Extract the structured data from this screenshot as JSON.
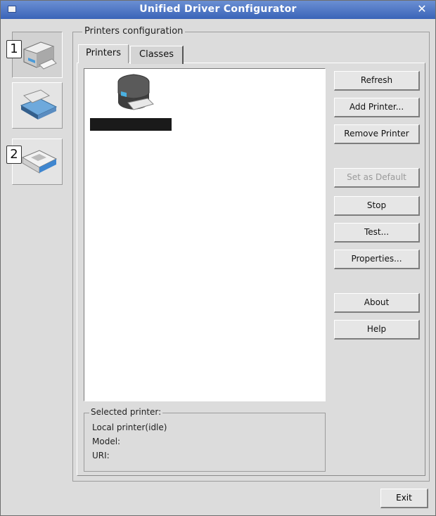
{
  "window": {
    "title": "Unified Driver Configurator"
  },
  "sidebar": {
    "items": [
      {
        "name": "printers-configuration",
        "icon": "printer-icon",
        "badge": "1",
        "active": true
      },
      {
        "name": "scanners-configuration",
        "icon": "scanner-icon",
        "badge": "",
        "active": false
      },
      {
        "name": "ports-configuration",
        "icon": "port-icon",
        "badge": "2",
        "active": false
      }
    ]
  },
  "group": {
    "label": "Printers configuration"
  },
  "tabs": [
    {
      "label": "Printers",
      "active": true
    },
    {
      "label": "Classes",
      "active": false
    }
  ],
  "printer_list": {
    "items": [
      {
        "icon": "printer-icon",
        "name": "",
        "name_redacted": true
      }
    ]
  },
  "buttons": {
    "refresh": "Refresh",
    "add_printer": "Add Printer...",
    "remove_printer": "Remove Printer",
    "set_default": "Set as Default",
    "stop": "Stop",
    "test": "Test...",
    "properties": "Properties...",
    "about": "About",
    "help": "Help",
    "exit": "Exit"
  },
  "selected_printer": {
    "label": "Selected printer:",
    "status": "Local printer(idle)",
    "model": "Model:",
    "uri": "URI:"
  },
  "colors": {
    "titlebar": "#3a64b8",
    "window_bg": "#dcdcdc",
    "list_bg": "#ffffff",
    "disabled_text": "#9a9a9a"
  }
}
